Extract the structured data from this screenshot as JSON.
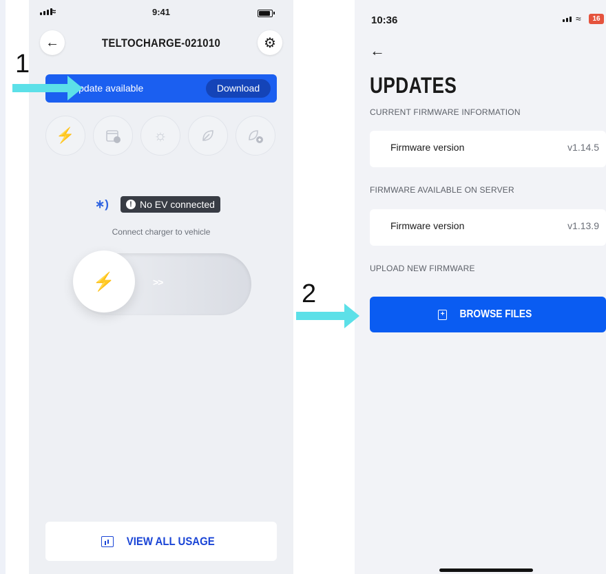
{
  "phone1": {
    "status_bar": {
      "time": "9:41",
      "wifi": "wifi-icon"
    },
    "header": {
      "title": "TELTOCHARGE-021010",
      "back_icon": "arrow-left-icon",
      "settings_icon": "gear-icon"
    },
    "update_banner": {
      "text": "Update available",
      "button_label": "Download",
      "color": "#1b5ff0"
    },
    "charge_modes": [
      {
        "icon": "lightning-icon"
      },
      {
        "icon": "schedule-calendar-icon"
      },
      {
        "icon": "solar-sun-icon"
      },
      {
        "icon": "eco-leaf-icon"
      },
      {
        "icon": "leaf-add-icon"
      }
    ],
    "connection": {
      "bluetooth_icon": "bluetooth-icon",
      "status": "No EV connected",
      "hint": "Connect charger to vehicle"
    },
    "slider": {
      "knob_icon": "lightning-icon",
      "chevrons": ">>"
    },
    "usage_button": {
      "label": "VIEW ALL USAGE",
      "icon": "chart-icon"
    }
  },
  "phone2": {
    "status_bar": {
      "time": "10:36",
      "battery": "16",
      "battery_color": "#e5533d"
    },
    "back_icon": "arrow-left-icon",
    "title": "UPDATES",
    "current_section": {
      "label": "CURRENT FIRMWARE INFORMATION",
      "key": "Firmware version",
      "value": "v1.14.5"
    },
    "server_section": {
      "label": "FIRMWARE AVAILABLE ON SERVER",
      "key": "Firmware version",
      "value": "v1.13.9"
    },
    "upload_section": {
      "label": "UPLOAD NEW FIRMWARE"
    },
    "browse_button": {
      "label": "BROWSE FILES",
      "icon": "file-add-icon",
      "color": "#0a5cf2"
    }
  },
  "annotations": {
    "step1": "1",
    "step2": "2",
    "arrow_color": "#5ce0e8"
  }
}
